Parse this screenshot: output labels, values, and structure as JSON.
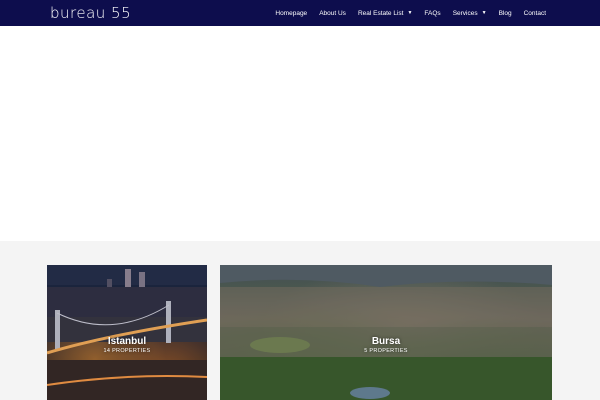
{
  "header": {
    "logo_text": "bureau 55",
    "nav": [
      {
        "label": "Homepage",
        "has_dropdown": false
      },
      {
        "label": "About Us",
        "has_dropdown": false
      },
      {
        "label": "Real Estate List",
        "has_dropdown": true
      },
      {
        "label": "FAQs",
        "has_dropdown": false
      },
      {
        "label": "Services",
        "has_dropdown": true
      },
      {
        "label": "Blog",
        "has_dropdown": false
      },
      {
        "label": "Contact",
        "has_dropdown": false
      }
    ],
    "caret_icon": "chevron-down-icon",
    "colors": {
      "background": "#0d0d4d",
      "text": "#ffffff"
    }
  },
  "locations": [
    {
      "city": "Istanbul",
      "count_text": "14 PROPERTIES"
    },
    {
      "city": "Bursa",
      "count_text": "5 PROPERTIES"
    }
  ]
}
